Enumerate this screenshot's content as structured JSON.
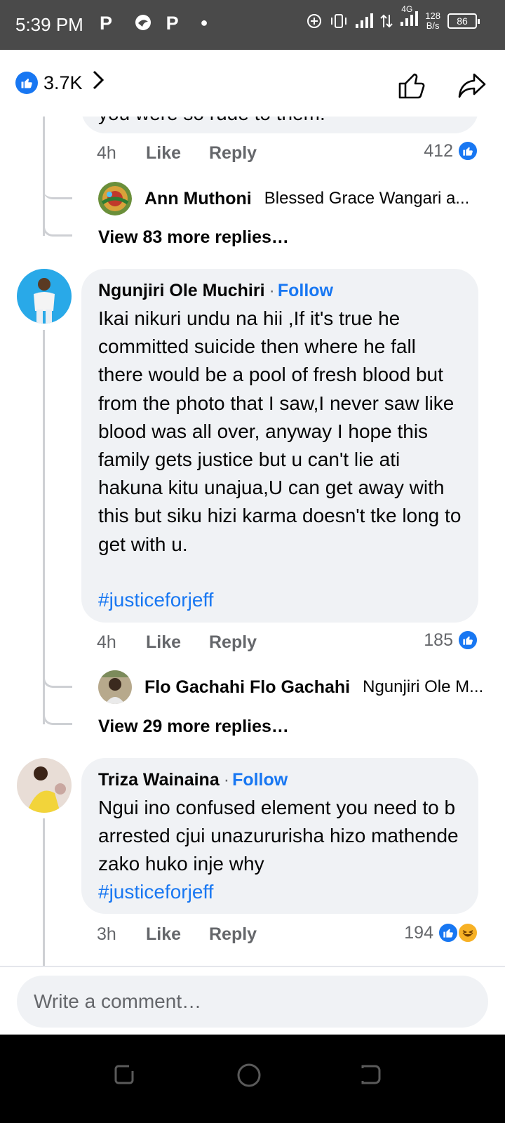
{
  "status_bar": {
    "time": "5:39 PM",
    "left_icons": [
      "P",
      "P"
    ],
    "net_speed_top": "128",
    "net_speed_bottom": "B/s",
    "network_type": "4G",
    "battery": "86"
  },
  "header": {
    "reaction_count": "3.7K"
  },
  "comments": [
    {
      "partial_text": "you were so rude to them.",
      "time": "4h",
      "like_label": "Like",
      "reply_label": "Reply",
      "reaction_count": "412",
      "reply_preview": {
        "name": "Ann Muthoni",
        "snippet": "Blessed Grace Wangari  a..."
      },
      "view_more": "View 83 more replies…"
    },
    {
      "author": "Ngunjiri Ole Muchiri",
      "follow_label": "Follow",
      "text": "Ikai nikuri undu na hii ,If it's true he committed suicide then where he fall there would be a pool of fresh blood but from the photo that I saw,I never saw like blood was all over, anyway I hope this family gets justice but u can't lie ati hakuna kitu unajua,U can get away with this but siku hizi karma doesn't tke long to get with u.",
      "hashtag": "#justiceforjeff",
      "time": "4h",
      "like_label": "Like",
      "reply_label": "Reply",
      "reaction_count": "185",
      "reply_preview": {
        "name": "Flo Gachahi Flo Gachahi",
        "snippet": "Ngunjiri Ole M..."
      },
      "view_more": "View 29 more replies…"
    },
    {
      "author": "Triza Wainaina",
      "follow_label": "Follow",
      "text": "Ngui ino confused element you need to b arrested cjui unazururisha hizo mathende zako huko inje why",
      "hashtag": "#justiceforjeff",
      "time": "3h",
      "like_label": "Like",
      "reply_label": "Reply",
      "reaction_count": "194"
    }
  ],
  "composer": {
    "placeholder": "Write a comment…"
  },
  "colors": {
    "accent": "#1877f2",
    "bubble": "#f0f2f5",
    "secondary_text": "#65676b"
  }
}
